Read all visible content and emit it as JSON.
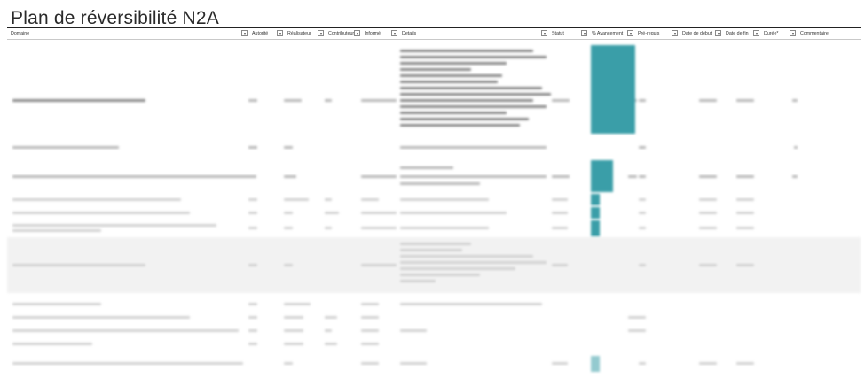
{
  "title": "Plan de réversibilité N2A",
  "columns": {
    "domaine": "Domaine",
    "autorite": "Autorité",
    "realisateur": "Réalisateur",
    "contributeur": "Contributeur",
    "informe": "Informé",
    "details": "Details",
    "statut": "Statut",
    "avancement": "% Avancement",
    "prerequis": "Pré-requis",
    "date_debut": "Date de début",
    "date_fin": "Date de fin",
    "duree": "Durée*",
    "commentaire": "Commentaire"
  },
  "accent_color": "#3a9ea8",
  "rows": [
    {
      "avancement": 1.0
    },
    {
      "avancement": 0.0
    },
    {
      "avancement": 0.5
    },
    {
      "avancement": 0.2
    },
    {
      "avancement": 0.2
    },
    {
      "avancement": 0.2
    },
    {
      "avancement": 0.0
    },
    {
      "avancement": 0.0
    },
    {
      "avancement": 0.0
    },
    {
      "avancement": 0.0
    },
    {
      "avancement": 0.0
    },
    {
      "avancement": 0.2
    }
  ]
}
